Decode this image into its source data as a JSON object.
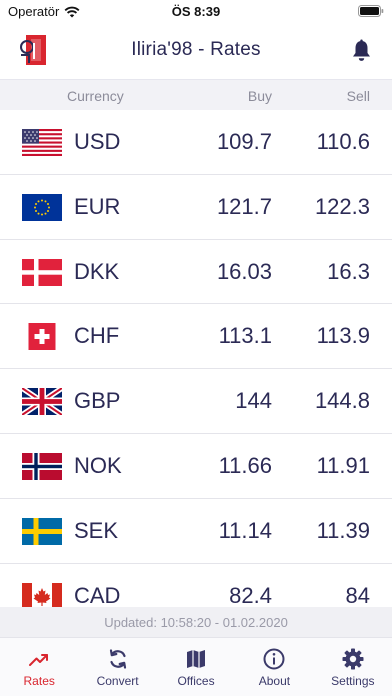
{
  "status_bar": {
    "carrier": "Operatör",
    "time": "ÖS 8:39"
  },
  "header": {
    "title": "Iliria'98 - Rates",
    "logo_icon": "iliria-logo",
    "bell_icon": "bell-icon"
  },
  "columns": {
    "currency": "Currency",
    "buy": "Buy",
    "sell": "Sell"
  },
  "rates": [
    {
      "code": "USD",
      "buy": "109.7",
      "sell": "110.6",
      "flag": "us-flag-icon"
    },
    {
      "code": "EUR",
      "buy": "121.7",
      "sell": "122.3",
      "flag": "eu-flag-icon"
    },
    {
      "code": "DKK",
      "buy": "16.03",
      "sell": "16.3",
      "flag": "dk-flag-icon"
    },
    {
      "code": "CHF",
      "buy": "113.1",
      "sell": "113.9",
      "flag": "ch-flag-icon"
    },
    {
      "code": "GBP",
      "buy": "144",
      "sell": "144.8",
      "flag": "gb-flag-icon"
    },
    {
      "code": "NOK",
      "buy": "11.66",
      "sell": "11.91",
      "flag": "no-flag-icon"
    },
    {
      "code": "SEK",
      "buy": "11.14",
      "sell": "11.39",
      "flag": "se-flag-icon"
    },
    {
      "code": "CAD",
      "buy": "82.4",
      "sell": "84",
      "flag": "ca-flag-icon"
    }
  ],
  "updated": "Updated: 10:58:20 - 01.02.2020",
  "tabs": [
    {
      "label": "Rates",
      "icon": "trending-up-icon",
      "active": true
    },
    {
      "label": "Convert",
      "icon": "refresh-icon",
      "active": false
    },
    {
      "label": "Offices",
      "icon": "map-icon",
      "active": false
    },
    {
      "label": "About",
      "icon": "info-icon",
      "active": false
    },
    {
      "label": "Settings",
      "icon": "gear-icon",
      "active": false
    }
  ],
  "colors": {
    "accent": "#d9262f",
    "primary_text": "#2b2a55",
    "muted": "#8c8c9a",
    "tab_icon": "#3b3a6a"
  }
}
